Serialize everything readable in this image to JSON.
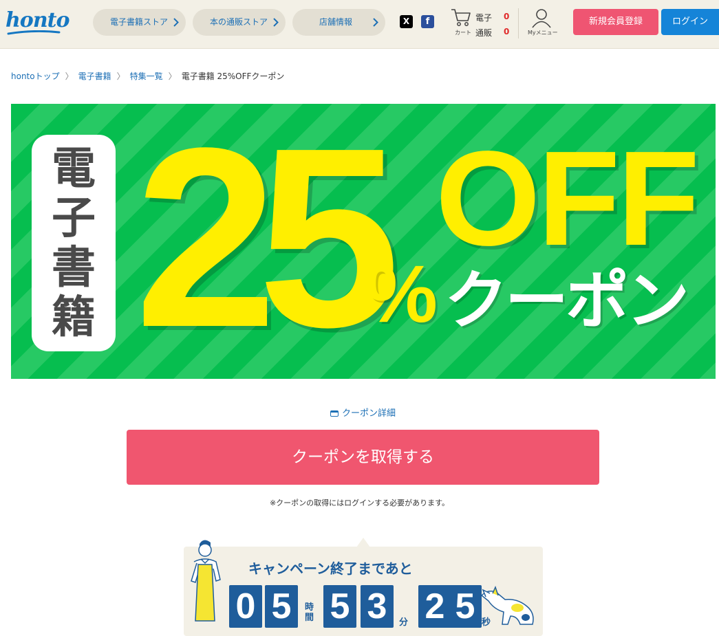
{
  "header": {
    "logo": "honto",
    "nav": [
      {
        "label": "電子書籍ストア"
      },
      {
        "label": "本の通販ストア"
      },
      {
        "label": "店舗情報"
      }
    ],
    "social": {
      "x": "X",
      "facebook": "f"
    },
    "cart": {
      "caption": "カート",
      "rows": [
        {
          "label": "電子",
          "count": "0"
        },
        {
          "label": "通販",
          "count": "0"
        }
      ]
    },
    "mymenu_label": "Myメニュー",
    "register_label": "新規会員登録",
    "login_label": "ログイン"
  },
  "breadcrumb": {
    "items": [
      "hontoトップ",
      "電子書籍",
      "特集一覧"
    ],
    "current": "電子書籍 25%OFFクーポン"
  },
  "banner": {
    "tag_chars": [
      "電",
      "子",
      "書",
      "籍"
    ],
    "big_number": "25",
    "percent": "%",
    "off": "OFF",
    "coupon": "クーポン"
  },
  "coupon": {
    "detail_link": "クーポン詳細",
    "get_button": "クーポンを取得する",
    "login_note": "※クーポンの取得にはログインする必要があります。"
  },
  "countdown": {
    "title": "キャンペーン終了まであと",
    "hours": [
      "0",
      "5"
    ],
    "hours_unit": "時間",
    "minutes": [
      "5",
      "3"
    ],
    "minutes_unit": "分",
    "seconds": [
      "2",
      "5"
    ],
    "seconds_unit": "秒"
  },
  "colors": {
    "brand_blue": "#1577c2",
    "register_pink": "#ef5572",
    "login_blue": "#1584d8",
    "banner_green": "#06be4f",
    "banner_yellow": "#ffef00",
    "get_button": "#f0566f",
    "countdown_navy": "#1f5d9b"
  }
}
